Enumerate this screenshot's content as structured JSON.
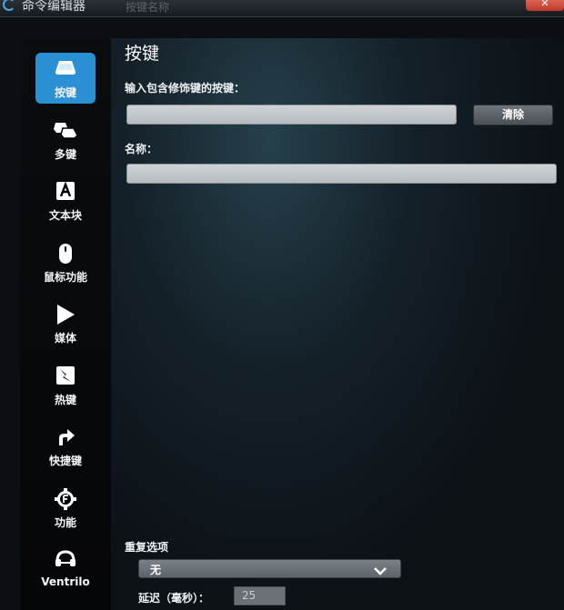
{
  "window": {
    "title": "命令编辑器",
    "faded_text": "按键名称"
  },
  "sidebar": {
    "items": [
      {
        "label": "按键",
        "icon": "key-icon",
        "active": true
      },
      {
        "label": "多键",
        "icon": "multi-key-icon"
      },
      {
        "label": "文本块",
        "icon": "text-block-icon"
      },
      {
        "label": "鼠标功能",
        "icon": "mouse-icon"
      },
      {
        "label": "媒体",
        "icon": "play-icon"
      },
      {
        "label": "热键",
        "icon": "hotkey-icon"
      },
      {
        "label": "快捷键",
        "icon": "shortcut-arrow-icon"
      },
      {
        "label": "功能",
        "icon": "function-gear-icon"
      },
      {
        "label": "Ventrilo",
        "icon": "headset-icon"
      }
    ]
  },
  "main": {
    "title": "按键",
    "keystroke_label": "输入包含修饰键的按键：",
    "keystroke_value": "",
    "clear_label": "清除",
    "name_label": "名称：",
    "name_value": "",
    "repeat_label": "重复选项",
    "repeat_value": "无",
    "delay_label": "延迟（毫秒）：",
    "delay_value": "25"
  },
  "colors": {
    "accent": "#2a8fd3",
    "close": "#c0392b"
  }
}
